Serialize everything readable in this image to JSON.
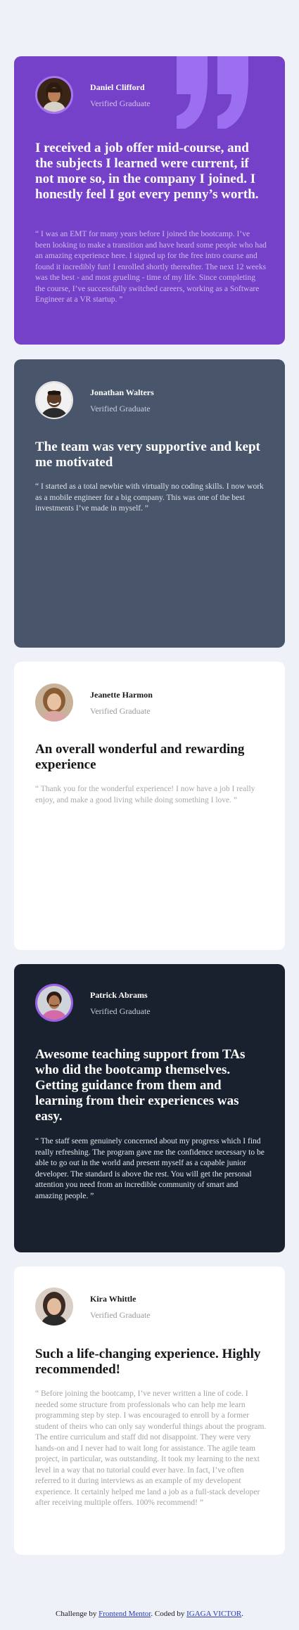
{
  "page": {
    "background": "#eef1f8"
  },
  "testimonials": [
    {
      "name": "Daniel Clifford",
      "role": "Verified Graduate",
      "headline": "I received a job offer mid-course, and the subjects I learned were current, if not more so, in the company I joined. I honestly feel I got every penny’s worth.",
      "body": "“ I was an EMT for many years before I joined the bootcamp. I’ve been looking to make a transition and have heard some people who had an amazing experience here. I signed up for the free intro course and found it incredibly fun! I enrolled shortly thereafter. The next 12 weeks was the best - and most grueling - time of my life. Since completing the course, I’ve successfully switched careers, working as a Software Engineer at a VR startup. ”",
      "background": "#7541c8",
      "decoration": "quotation-mark-icon"
    },
    {
      "name": "Jonathan Walters",
      "role": "Verified Graduate",
      "headline": "The team was very supportive and kept me motivated",
      "body": "“ I started as a total newbie with virtually no coding skills. I now work as a mobile engineer for a big company. This was one of the best investments I’ve made in myself. ”",
      "background": "#48556a"
    },
    {
      "name": "Jeanette Harmon",
      "role": "Verified Graduate",
      "headline": "An overall wonderful and rewarding experience",
      "body": "“ Thank you for the wonderful experience! I now have a job I really enjoy, and make a good living while doing something I love. ”",
      "background": "#ffffff"
    },
    {
      "name": "Patrick Abrams",
      "role": "Verified Graduate",
      "headline": "Awesome teaching support from TAs who did the bootcamp themselves. Getting guidance from them and learning from their experiences was easy.",
      "body": "“ The staff seem genuinely concerned about my progress which I find really refreshing. The program gave me the confidence necessary to be able to go out in the world and present myself as a capable junior developer. The standard is above the rest. You will get the personal attention you need from an incredible community of smart and amazing people. ”",
      "background": "#19212e"
    },
    {
      "name": "Kira Whittle",
      "role": "Verified Graduate",
      "headline": "Such a life-changing experience. Highly recommended!",
      "body": "“ Before joining the bootcamp, I’ve never written a line of code. I needed some structure from professionals who can help me learn programming step by step. I was encouraged to enroll by a former student of theirs who can only say wonderful things about the program. The entire curriculum and staff did not disappoint. They were very hands-on and I never had to wait long for assistance. The agile team project, in particular, was outstanding. It took my learning to the next level in a way that no tutorial could ever have. In fact, I’ve often referred to it during interviews as an example of my developent experience. It certainly helped me land a job as a full-stack developer after receiving multiple offers. 100% recommend! ”",
      "background": "#ffffff"
    }
  ],
  "footer": {
    "prefix": "Challenge by",
    "mentor_link": "Frontend Mentor",
    "middle": ". Coded by",
    "author_link": "IGAGA VICTOR",
    "suffix": "."
  }
}
